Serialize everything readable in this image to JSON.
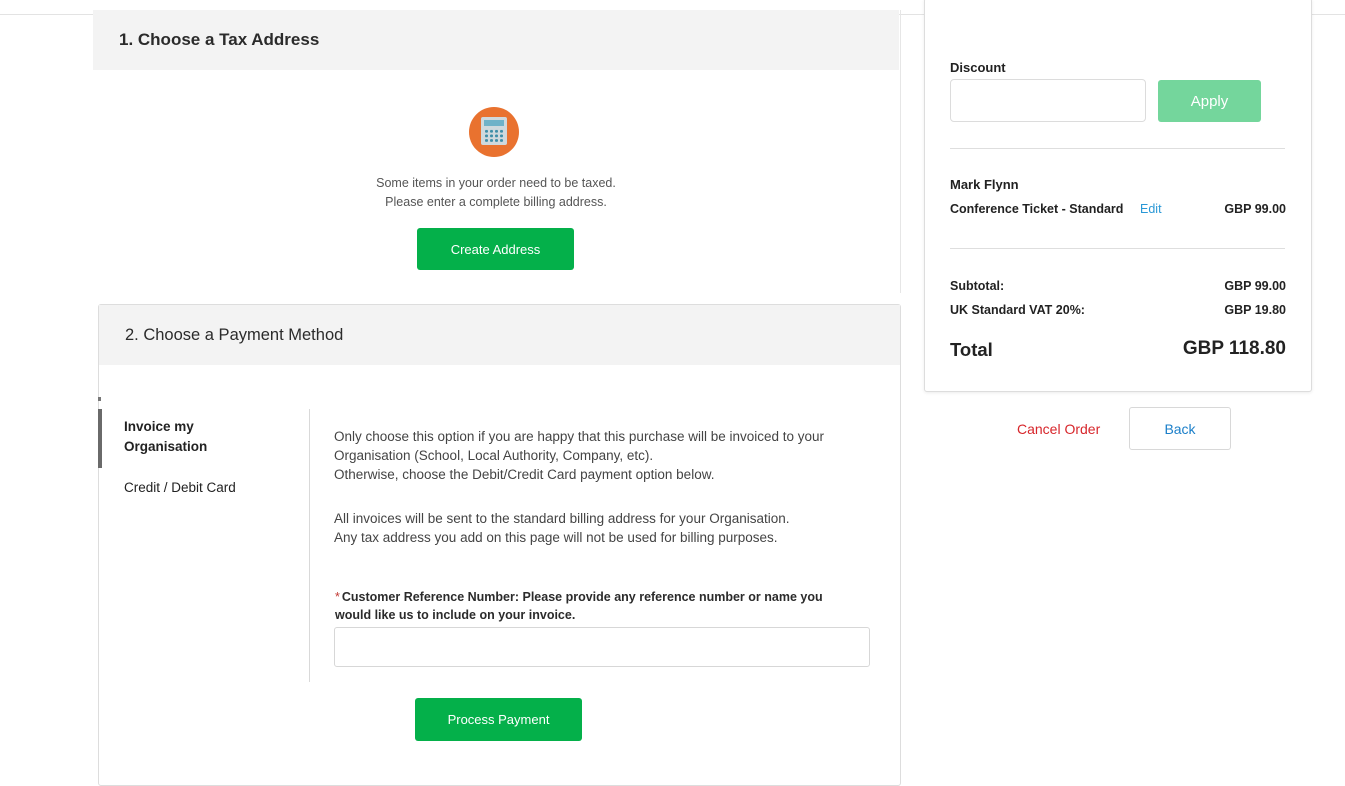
{
  "tax_section": {
    "title": "1. Choose a Tax Address",
    "icon": "calculator-icon",
    "message_line1": "Some items in your order need to be taxed.",
    "message_line2": "Please enter a complete billing address.",
    "create_button": "Create Address"
  },
  "payment_section": {
    "title": "2. Choose a Payment Method",
    "methods": [
      {
        "label": "Invoice my Organisation",
        "active": true
      },
      {
        "label": "Credit / Debit Card",
        "active": false
      }
    ],
    "invoice_text_1a": "Only choose this option if you are happy that this purchase will be invoiced to your",
    "invoice_text_1b": "Organisation (School, Local Authority, Company, etc).",
    "invoice_text_1c": "Otherwise, choose the Debit/Credit Card payment option below.",
    "invoice_text_2a": "All invoices will be sent to the standard billing address for your Organisation.",
    "invoice_text_2b": "Any tax address you add on this page will not be used for billing purposes.",
    "reference_required_mark": "*",
    "reference_label": "Customer Reference Number: Please provide any reference number or name you would like us to include on your invoice.",
    "reference_value": "",
    "process_button": "Process Payment"
  },
  "summary": {
    "discount_label": "Discount",
    "discount_value": "",
    "apply_button": "Apply",
    "attendee": "Mark Flynn",
    "item_name": "Conference Ticket - Standard",
    "edit_link": "Edit",
    "item_price": "GBP 99.00",
    "subtotal_label": "Subtotal:",
    "subtotal_value": "GBP 99.00",
    "vat_label": "UK Standard VAT 20%:",
    "vat_value": "GBP 19.80",
    "total_label": "Total",
    "total_value": "GBP 118.80"
  },
  "actions": {
    "cancel": "Cancel Order",
    "back": "Back"
  },
  "colors": {
    "primary_green": "#04b04a",
    "apply_green": "#74d69c",
    "cancel_red": "#d7262b",
    "link_blue": "#2a98d6",
    "icon_orange": "#e9722f"
  }
}
